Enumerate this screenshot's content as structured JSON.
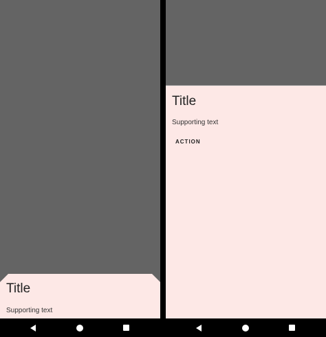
{
  "left_screen": {
    "card": {
      "title": "Title",
      "supporting_text": "Supporting text"
    },
    "navbar": {
      "back_icon": "back-triangle-icon",
      "home_icon": "home-circle-icon",
      "recents_icon": "recents-square-icon"
    }
  },
  "right_screen": {
    "card": {
      "title": "Title",
      "supporting_text": "Supporting text",
      "action_label": "ACTION"
    },
    "navbar": {
      "back_icon": "back-triangle-icon",
      "home_icon": "home-circle-icon",
      "recents_icon": "recents-square-icon"
    }
  },
  "colors": {
    "scrim": "#646464",
    "sheet_background": "#fde8e6",
    "navbar_background": "#000000",
    "text": "#222222"
  }
}
